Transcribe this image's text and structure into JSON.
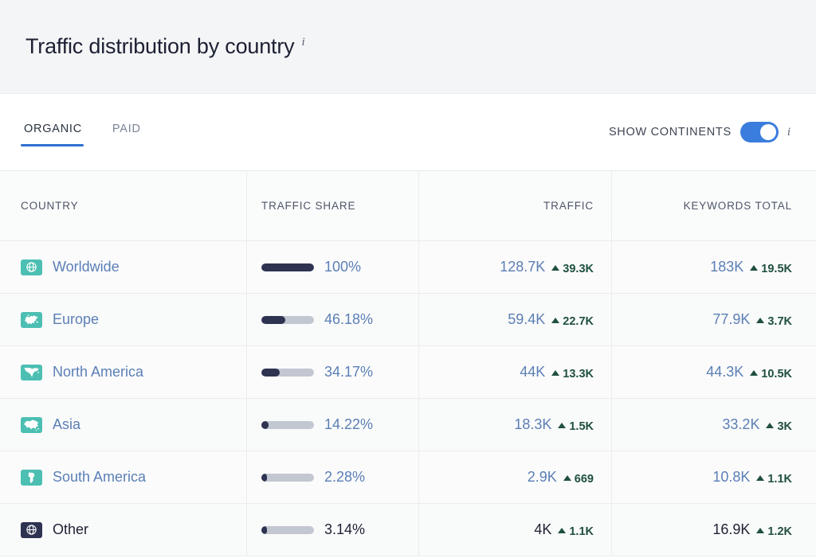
{
  "header": {
    "title": "Traffic distribution by country",
    "info_icon": "info-icon",
    "info_glyph": "i"
  },
  "tabs": {
    "items": [
      {
        "label": "ORGANIC",
        "active": true
      },
      {
        "label": "PAID",
        "active": false
      }
    ],
    "toggle": {
      "label": "SHOW CONTINENTS",
      "state": "on",
      "info_glyph": "i",
      "accent_color": "#3b7ddd"
    }
  },
  "table": {
    "columns": [
      {
        "key": "country",
        "label": "COUNTRY"
      },
      {
        "key": "share",
        "label": "TRAFFIC SHARE"
      },
      {
        "key": "traffic",
        "label": "TRAFFIC"
      },
      {
        "key": "keywords",
        "label": "KEYWORDS TOTAL"
      }
    ],
    "rows": [
      {
        "country": "Worldwide",
        "icon": "globe-icon",
        "icon_style": "teal",
        "link": true,
        "share_pct": "100%",
        "share_value": 100,
        "traffic": "128.7K",
        "traffic_delta": "39.3K",
        "traffic_trend": "up",
        "keywords": "183K",
        "keywords_delta": "19.5K",
        "keywords_trend": "up"
      },
      {
        "country": "Europe",
        "icon": "europe-map-icon",
        "icon_style": "teal",
        "link": true,
        "share_pct": "46.18%",
        "share_value": 46.18,
        "traffic": "59.4K",
        "traffic_delta": "22.7K",
        "traffic_trend": "up",
        "keywords": "77.9K",
        "keywords_delta": "3.7K",
        "keywords_trend": "up"
      },
      {
        "country": "North America",
        "icon": "north-america-map-icon",
        "icon_style": "teal",
        "link": true,
        "share_pct": "34.17%",
        "share_value": 34.17,
        "traffic": "44K",
        "traffic_delta": "13.3K",
        "traffic_trend": "up",
        "keywords": "44.3K",
        "keywords_delta": "10.5K",
        "keywords_trend": "up"
      },
      {
        "country": "Asia",
        "icon": "asia-map-icon",
        "icon_style": "teal",
        "link": true,
        "share_pct": "14.22%",
        "share_value": 14.22,
        "traffic": "18.3K",
        "traffic_delta": "1.5K",
        "traffic_trend": "up",
        "keywords": "33.2K",
        "keywords_delta": "3K",
        "keywords_trend": "up"
      },
      {
        "country": "South America",
        "icon": "south-america-map-icon",
        "icon_style": "teal",
        "link": true,
        "share_pct": "2.28%",
        "share_value": 2.28,
        "traffic": "2.9K",
        "traffic_delta": "669",
        "traffic_trend": "up",
        "keywords": "10.8K",
        "keywords_delta": "1.1K",
        "keywords_trend": "up"
      },
      {
        "country": "Other",
        "icon": "globe-icon",
        "icon_style": "dark",
        "link": false,
        "share_pct": "3.14%",
        "share_value": 3.14,
        "traffic": "4K",
        "traffic_delta": "1.1K",
        "traffic_trend": "up",
        "keywords": "16.9K",
        "keywords_delta": "1.2K",
        "keywords_trend": "up"
      }
    ]
  },
  "colors": {
    "link": "#5b7fb5",
    "bar_fill": "#2d3350",
    "bar_track": "#c2c7d1",
    "teal_badge": "#4cbfb2",
    "dark_badge": "#2d3350",
    "delta_green": "#205040",
    "tab_accent": "#2f6fd0"
  }
}
